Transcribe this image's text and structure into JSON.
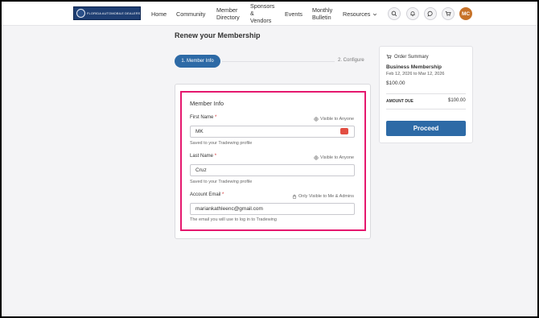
{
  "header": {
    "logo_text": "FLORIDA AUTOMOBILE DEALERS ASSOCIATION",
    "nav": {
      "home": "Home",
      "community": "Community",
      "member_directory_1": "Member",
      "member_directory_2": "Directory",
      "sponsors_1": "Sponsors",
      "sponsors_2": "&",
      "sponsors_3": "Vendors",
      "events": "Events",
      "bulletin_1": "Monthly",
      "bulletin_2": "Bulletin",
      "resources": "Resources"
    },
    "icons": [
      "search-icon",
      "bell-icon",
      "chat-icon",
      "cart-icon"
    ],
    "avatar_initials": "MC"
  },
  "page": {
    "title": "Renew your Membership",
    "steps": {
      "active": "1. Member Info",
      "next": "2. Configure"
    }
  },
  "form": {
    "section_title": "Member Info",
    "required_mark": "*",
    "first_name": {
      "label": "First Name",
      "visibility": "Visible to Anyone",
      "value": "MK",
      "hint": "Saved to your Tradewing profile"
    },
    "last_name": {
      "label": "Last Name",
      "visibility": "Visible to Anyone",
      "value": "Cruz",
      "hint": "Saved to your Tradewing profile"
    },
    "email": {
      "label": "Account Email",
      "visibility": "Only Visible to Me & Admins",
      "value": "mariankathleenc@gmail.com",
      "hint": "The email you will use to log in to Tradewing"
    }
  },
  "order_summary": {
    "title": "Order Summary",
    "item_name": "Business Membership",
    "item_dates": "Feb 12, 2026 to Mar 12, 2026",
    "item_price": "$100.00",
    "amount_due_label": "AMOUNT DUE",
    "amount_due_value": "$100.00",
    "proceed_label": "Proceed"
  },
  "colors": {
    "primary": "#2d6aa6",
    "highlight": "#e5186e",
    "avatar": "#c77228",
    "logo_bg": "#1f3f73"
  }
}
